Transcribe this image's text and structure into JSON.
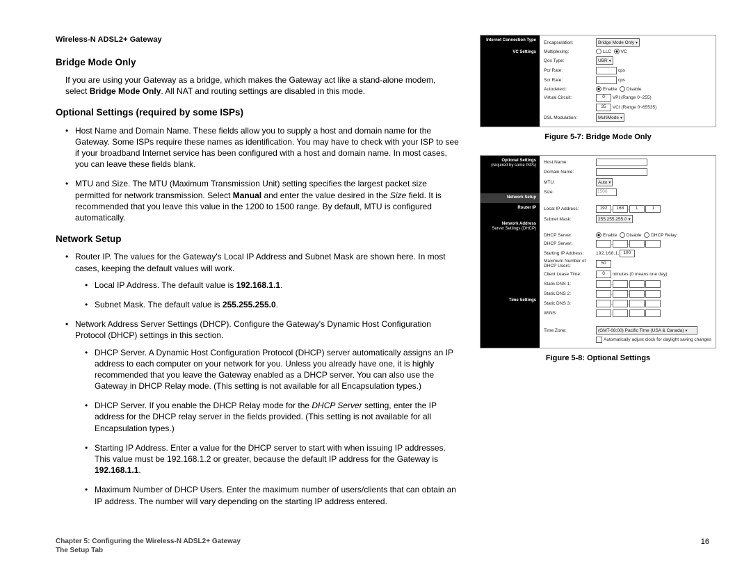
{
  "product_line": "Wireless-N ADSL2+ Gateway",
  "sections": {
    "s1": {
      "title": "Bridge Mode Only",
      "para": "If you are using your Gateway as a bridge, which makes the Gateway act like a stand-alone modem, select Bridge Mode Only. All NAT and routing settings are disabled in this mode.",
      "bold": "Bridge Mode Only"
    },
    "s2": {
      "title": "Optional Settings (required by some ISPs)",
      "li1": "Host Name and Domain Name. These fields allow you to supply a host and domain name for the Gateway. Some ISPs require these names as identification. You may have to check with your ISP to see if your broadband Internet service has been configured with a host and domain name. In most cases, you can leave these fields blank.",
      "li2_pre": "MTU and Size. The MTU (Maximum Transmission Unit) setting specifies the largest packet size permitted for network transmission. Select ",
      "li2_manual": "Manual",
      "li2_mid": " and enter the value desired in the ",
      "li2_size": "Size",
      "li2_post": " field. It is recommended that you leave this value in the 1200 to 1500 range. By default, MTU is configured automatically."
    },
    "s3": {
      "title": "Network Setup",
      "li1": "Router IP. The values for the Gateway's Local IP Address and Subnet Mask are shown here. In most cases, keeping the default values will work.",
      "li1a_pre": "Local IP Address. The default value is ",
      "li1a_b": "192.168.1.1",
      "li1b_pre": "Subnet Mask. The default value is ",
      "li1b_b": "255.255.255.0",
      "li2": "Network Address Server Settings (DHCP). Configure the Gateway's Dynamic Host Configuration Protocol (DHCP) settings in this section.",
      "li2a": "DHCP Server. A Dynamic Host Configuration Protocol (DHCP) server automatically assigns an IP address to each computer on your network for you. Unless you already have one, it is highly recommended that you leave the Gateway enabled as a DHCP server. You can also use the Gateway in DHCP Relay mode. (This setting is not available for all Encapsulation types.)",
      "li2b_pre": "DHCP Server. If you enable the DHCP Relay mode for the ",
      "li2b_i": "DHCP Server",
      "li2b_post": " setting, enter the IP address for the DHCP relay server in the fields provided. (This setting is not available for all Encapsulation types.)",
      "li2c_pre": "Starting IP Address. Enter a value for the DHCP server to start with when issuing IP addresses. This value must be 192.168.1.2 or greater, because the default IP address for the Gateway is ",
      "li2c_b": "192.168.1.1",
      "li2d": "Maximum Number of DHCP Users. Enter the maximum number of users/clients that can obtain an IP address. The number will vary depending on the starting IP address entered."
    }
  },
  "footer": {
    "l1": "Chapter 5: Configuring the Wireless-N ADSL2+ Gateway",
    "l2": "The Setup Tab",
    "page": "16"
  },
  "fig7": {
    "caption": "Figure 5-7: Bridge Mode Only",
    "tab1": "Internet Connection Type",
    "tab2": "VC Settings",
    "encap_l": "Encapsulation:",
    "encap_v": "Bridge Mode Only",
    "mux_l": "Multiplexing:",
    "mux_llc": "LLC",
    "mux_vc": "VC",
    "qos_l": "Qos Type:",
    "qos_v": "UBR",
    "pcr_l": "Pcr Rate:",
    "pcr_u": "cps",
    "scr_l": "Scr Rate:",
    "scr_u": "cps",
    "auto_l": "Autodetect:",
    "auto_en": "Enable",
    "auto_dis": "Disable",
    "vc_l": "Virtual Circuit:",
    "vc_vpi": "0",
    "vc_vpi_r": "VPI (Range 0~255)",
    "vc_vci": "35",
    "vc_vci_r": "VCI (Range 0~65535)",
    "dsl_l": "DSL Modulation:",
    "dsl_v": "MultiMode"
  },
  "fig8": {
    "caption": "Figure 5-8: Optional Settings",
    "tab1": "Optional Settings",
    "tab1b": "(required by some ISPs)",
    "tab2": "Network Setup",
    "tab2a": "Router IP",
    "tab3": "Network Address",
    "tab3b": "Server Settings (DHCP)",
    "tab4": "Time Settings",
    "host_l": "Host Name:",
    "dom_l": "Domain Name:",
    "mtu_l": "MTU:",
    "mtu_v": "Auto",
    "size_l": "Size:",
    "size_v": "1500",
    "lip_l": "Local IP Address:",
    "lip_v": [
      "192",
      "168",
      "1",
      "1"
    ],
    "mask_l": "Subnet Mask:",
    "mask_v": "255.255.255.0",
    "dhcp_l": "DHCP Server:",
    "dhcp_en": "Enable",
    "dhcp_dis": "Disable",
    "dhcp_rel": "DHCP Relay",
    "dhcps_l": "DHCP Server:",
    "sip_l": "Starting IP Address:",
    "sip_v": [
      "192",
      "168",
      "1",
      "100"
    ],
    "max_l": "Maximum Number of DHCP Users:",
    "max_v": "50",
    "lease_l": "Client Lease Time:",
    "lease_v": "0",
    "lease_u": "minutes (0 means one day)",
    "dns1_l": "Static DNS 1:",
    "dns2_l": "Static DNS 2:",
    "dns3_l": "Static DNS 3:",
    "wins_l": "WINS:",
    "tz_l": "Time Zone:",
    "tz_v": "(GMT-08:00) Pacific Time (USA & Canada)",
    "tz_cb": "Automatically adjust clock for daylight saving changes"
  }
}
